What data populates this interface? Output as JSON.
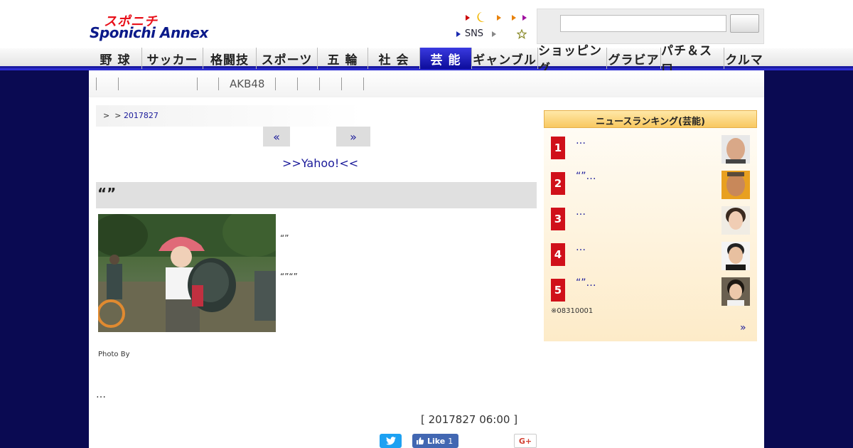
{
  "header": {
    "logo_top": "スポニチ",
    "logo_main": "Sponichi Annex",
    "sns_label": "SNS",
    "search": {
      "placeholder": "",
      "button_label": ""
    }
  },
  "global_nav": [
    {
      "label": "野 球",
      "active": false
    },
    {
      "label": "サッカー",
      "active": false
    },
    {
      "label": "格闘技",
      "active": false
    },
    {
      "label": "スポーツ",
      "active": false
    },
    {
      "label": "五 輪",
      "active": false
    },
    {
      "label": "社 会",
      "active": false
    },
    {
      "label": "芸 能",
      "active": true
    },
    {
      "label": "ギャンブル",
      "active": false
    },
    {
      "label": "ショッピング",
      "active": false
    },
    {
      "label": "グラビア",
      "active": false
    },
    {
      "label": "パチ＆スロ",
      "active": false
    },
    {
      "label": "クルマ",
      "active": false
    }
  ],
  "sub_nav": {
    "akb_label": "AKB48"
  },
  "breadcrumb": {
    "prefix": ">  > ",
    "date_link": "2017827"
  },
  "pager": {
    "prev": "«",
    "next": "»"
  },
  "yahoo_link": ">>Yahoo!<<",
  "article": {
    "headline": "“”",
    "quote1": "“”",
    "quote2": "“”“”",
    "photo_credit": "Photo By",
    "body": "…",
    "timestamp": "[ 2017827 06:00 ]"
  },
  "share": {
    "facebook_label": "Like",
    "facebook_count": "1",
    "gplus_label": "G+"
  },
  "ranking": {
    "title": "ニュースランキング(芸能)",
    "items": [
      {
        "rank": "1",
        "text": "…"
      },
      {
        "rank": "2",
        "text": "“”…"
      },
      {
        "rank": "3",
        "text": "…"
      },
      {
        "rank": "4",
        "text": "…"
      },
      {
        "rank": "5",
        "text": "“”…"
      }
    ],
    "note": "※08310001",
    "more": "»"
  },
  "colors": {
    "page_bg": "#0a0a52",
    "nav_active": "#1a1aa0",
    "link": "#1a1a9a",
    "rank_badge": "#d0101a",
    "twitter": "#1da1f2",
    "facebook": "#4267b2"
  }
}
